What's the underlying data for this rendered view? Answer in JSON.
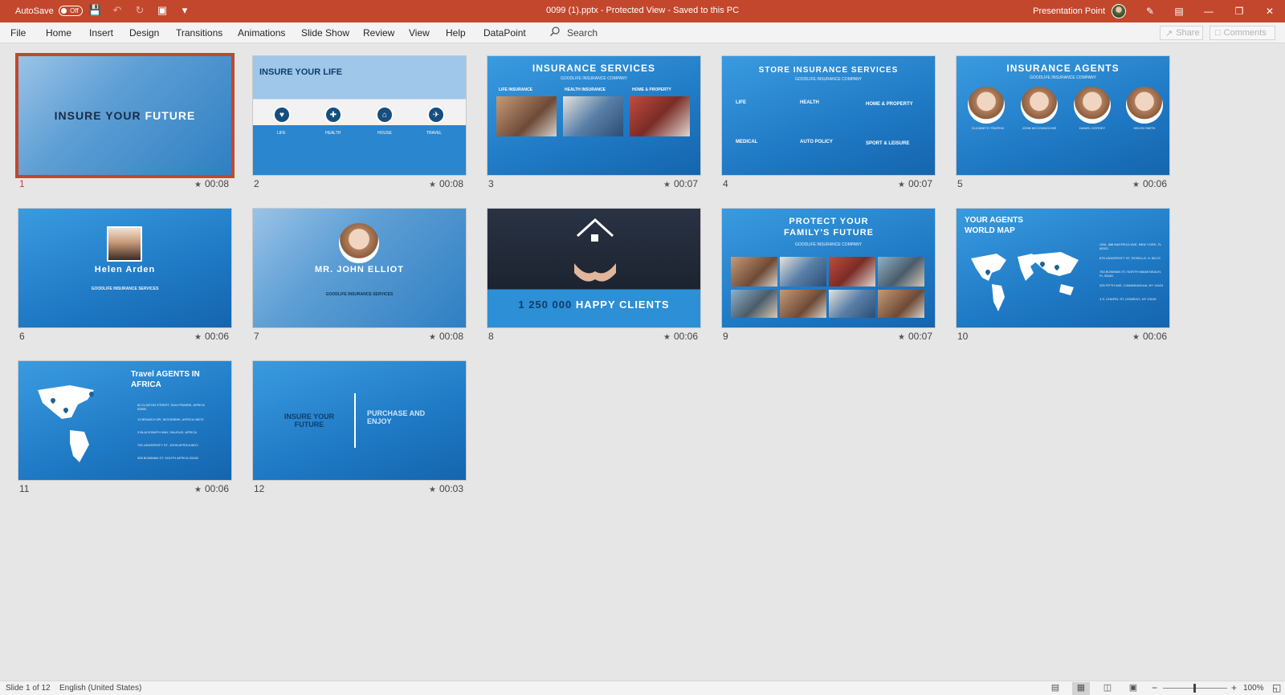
{
  "titlebar": {
    "autosave_label": "AutoSave",
    "autosave_state": "Off",
    "document_title": "0099 (1).pptx  -  Protected View  -  Saved to this PC",
    "user_name": "Presentation Point"
  },
  "ribbon": {
    "tabs": [
      "File",
      "Home",
      "Insert",
      "Design",
      "Transitions",
      "Animations",
      "Slide Show",
      "Review",
      "View",
      "Help",
      "DataPoint"
    ],
    "search_label": "Search",
    "share_label": "Share",
    "comments_label": "Comments"
  },
  "slides": [
    {
      "number": "1",
      "time": "00:08",
      "title_a": "INSURE YOUR ",
      "title_b": "FUTURE"
    },
    {
      "number": "2",
      "time": "00:08",
      "title": "INSURE YOUR LIFE",
      "items": [
        "LIFE",
        "HEALTH",
        "HOUSE",
        "TRAVEL"
      ]
    },
    {
      "number": "3",
      "time": "00:07",
      "title": "INSURANCE SERVICES",
      "subtitle": "GOODLIFE INSURANCE COMPANY",
      "columns": [
        "LIFE INSURANCE",
        "HEALTH INSURANCE",
        "HOME & PROPERTY"
      ]
    },
    {
      "number": "4",
      "time": "00:07",
      "title": "STORE INSURANCE SERVICES",
      "subtitle": "GOODLIFE INSURANCE COMPANY",
      "items": [
        "LIFE",
        "HEALTH",
        "HOME & PROPERTY",
        "MEDICAL",
        "AUTO POLICY",
        "SPORT & LEISURE"
      ]
    },
    {
      "number": "5",
      "time": "00:06",
      "title": "INSURANCE AGENTS",
      "subtitle": "GOODLIFE INSURANCE COMPANY",
      "agents": [
        "ELIZABETH TRATEIN",
        "JOHN MCCONNOCHIE",
        "DANIEL DORSEY",
        "HELEN SMITH"
      ]
    },
    {
      "number": "6",
      "time": "00:06",
      "title": "Helen Arden",
      "subtitle": "GOODLIFE INSURANCE SERVICES"
    },
    {
      "number": "7",
      "time": "00:08",
      "title": "MR. JOHN ELLIOT",
      "subtitle": "GOODLIFE INSURANCE SERVICES"
    },
    {
      "number": "8",
      "time": "00:06",
      "title_a": "1 250 000 ",
      "title_b": "HAPPY CLIENTS"
    },
    {
      "number": "9",
      "time": "00:07",
      "title": "PROTECT YOUR FAMILY'S FUTURE",
      "subtitle": "GOODLIFE INSURANCE COMPANY"
    },
    {
      "number": "10",
      "time": "00:06",
      "title": "YOUR AGENTS WORLD MAP",
      "addresses": [
        "USA, 488 MAYFIELD AVE, NEW YORK, FL 65321",
        "878 UNIVERSITY ST, ROSELLE, IL 60172",
        "754 BOWMAN ST, NORTH MIAMI BEACH, FL 33160",
        "325 FIFTH AVE, CANANDAIGUA, NY 14424",
        "4 S. CHAPEL ST, OSWEGO, NY 13126"
      ]
    },
    {
      "number": "11",
      "time": "00:06",
      "title": "Travel AGENTS IN AFRICA",
      "addresses": [
        "82 CLINTON STREET, SUN PRAIRIE, AFRICA 53590",
        "12 BRANCH DR, WOODBINE, AFRICA 08270",
        "3 BLACKSMITH WAY, SAUGUS, AFRICA",
        "700 UNIVERSITY ST, JOHN AFRICA 8871",
        "305 BOWMAN ST, SOUTH AFRICA 33160"
      ]
    },
    {
      "number": "12",
      "time": "00:03",
      "left_text": "INSURE YOUR FUTURE",
      "right_text": "PURCHASE AND ENJOY"
    }
  ],
  "statusbar": {
    "slide_count": "Slide 1 of 12",
    "language": "English (United States)",
    "zoom": "100%"
  }
}
